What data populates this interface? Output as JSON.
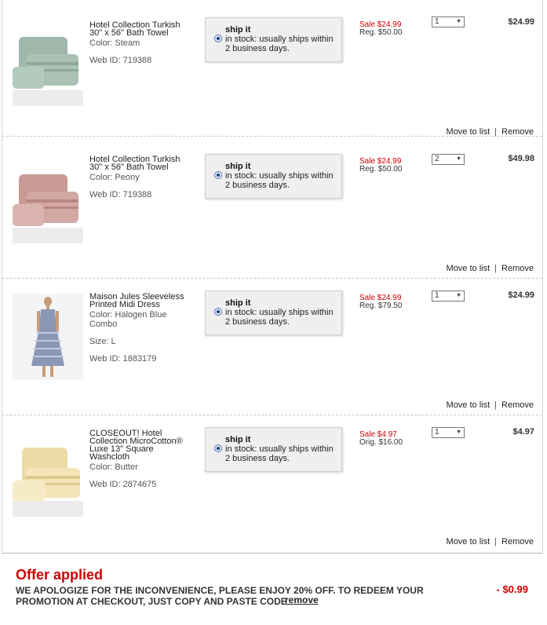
{
  "items": [
    {
      "name": "Hotel Collection Turkish 30\" x 56\" Bath Towel",
      "color": "Color: Steam",
      "size": "",
      "web_id": "Web ID: 719388",
      "ship_title": "ship it",
      "ship_desc": "in stock: usually ships within 2 business days.",
      "sale": "Sale $24.99",
      "reg": "Reg. $50.00",
      "qty": "1",
      "total": "$24.99",
      "move": "Move to list",
      "remove": "Remove",
      "thumb_color": "#9fb8ab"
    },
    {
      "name": "Hotel Collection Turkish 30\" x 56\" Bath Towel",
      "color": "Color: Peony",
      "size": "",
      "web_id": "Web ID: 719388",
      "ship_title": "ship it",
      "ship_desc": "in stock: usually ships within 2 business days.",
      "sale": "Sale $24.99",
      "reg": "Reg. $50.00",
      "qty": "2",
      "total": "$49.98",
      "move": "Move to list",
      "remove": "Remove",
      "thumb_color": "#c99a95"
    },
    {
      "name": "Maison Jules Sleeveless Printed Midi Dress",
      "color": "Color: Halogen Blue Combo",
      "size": "Size: L",
      "web_id": "Web ID: 1883179",
      "ship_title": "ship it",
      "ship_desc": "in stock: usually ships within 2 business days.",
      "sale": "Sale $24.99",
      "reg": "Reg. $79.50",
      "qty": "1",
      "total": "$24.99",
      "move": "Move to list",
      "remove": "Remove",
      "thumb_color": "#8a97b5"
    },
    {
      "name": "CLOSEOUT! Hotel Collection MicroCotton® Luxe 13\" Square Washcloth",
      "color": "Color: Butter",
      "size": "",
      "web_id": "Web ID: 2874675",
      "ship_title": "ship it",
      "ship_desc": "in stock: usually ships within 2 business days.",
      "sale": "Sale $4.97",
      "reg": "Orig. $16.00",
      "qty": "1",
      "total": "$4.97",
      "move": "Move to list",
      "remove": "Remove",
      "thumb_color": "#eedca7"
    }
  ],
  "offer": {
    "title": "Offer applied",
    "message": "WE APOLOGIZE FOR THE INCONVENIENCE, PLEASE ENJOY 20% OFF. TO REDEEM YOUR PROMOTION AT CHECKOUT, JUST COPY AND PASTE CODE",
    "remove": "remove",
    "amount": "- $0.99"
  },
  "colors": {
    "sale": "#cc0000",
    "panel": "#efefef"
  },
  "icons": {
    "radio": "radio-selected-icon",
    "dropdown": "dropdown-arrow-icon"
  }
}
